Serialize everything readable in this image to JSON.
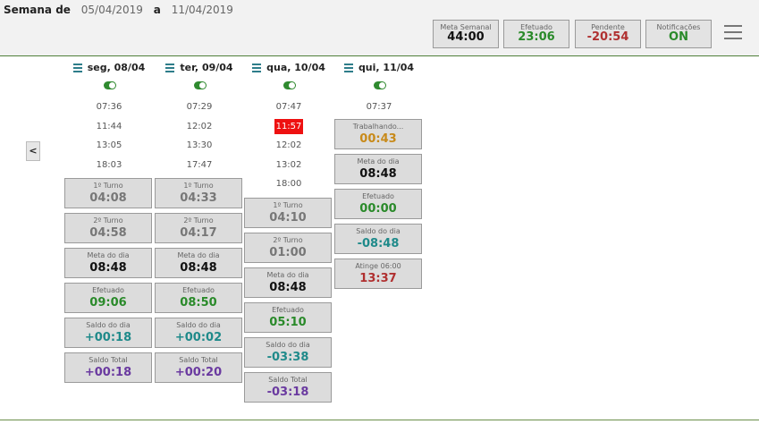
{
  "header": {
    "prefix": "Semana de",
    "start": "05/04/2019",
    "connector": "a",
    "end": "11/04/2019"
  },
  "stats": [
    {
      "label": "Meta Semanal",
      "value": "44:00",
      "color": "#111111"
    },
    {
      "label": "Efetuado",
      "value": "23:06",
      "color": "#2a8a2a"
    },
    {
      "label": "Pendente",
      "value": "-20:54",
      "color": "#b03030"
    },
    {
      "label": "Notificações",
      "value": "ON",
      "color": "#2a8a2a"
    }
  ],
  "colors": {
    "green": "#2a8a2a",
    "teal": "#1f8a8a",
    "purple": "#6a3aa0",
    "red": "#b03030",
    "orange": "#c88a1a"
  },
  "days": [
    {
      "label": "seg, 08/04",
      "punches": [
        "07:36",
        "11:44",
        "13:05",
        "18:03"
      ],
      "cards": [
        {
          "label": "1º Turno",
          "value": "04:08",
          "color": "#777777"
        },
        {
          "label": "2º Turno",
          "value": "04:58",
          "color": "#777777"
        },
        {
          "label": "Meta do dia",
          "value": "08:48",
          "color": "#111111"
        },
        {
          "label": "Efetuado",
          "value": "09:06",
          "color": "#2a8a2a"
        },
        {
          "label": "Saldo do dia",
          "value": "+00:18",
          "color": "#1f8a8a"
        },
        {
          "label": "Saldo Total",
          "value": "+00:18",
          "color": "#6a3aa0"
        }
      ]
    },
    {
      "label": "ter, 09/04",
      "punches": [
        "07:29",
        "12:02",
        "13:30",
        "17:47"
      ],
      "cards": [
        {
          "label": "1º Turno",
          "value": "04:33",
          "color": "#777777"
        },
        {
          "label": "2º Turno",
          "value": "04:17",
          "color": "#777777"
        },
        {
          "label": "Meta do dia",
          "value": "08:48",
          "color": "#111111"
        },
        {
          "label": "Efetuado",
          "value": "08:50",
          "color": "#2a8a2a"
        },
        {
          "label": "Saldo do dia",
          "value": "+00:02",
          "color": "#1f8a8a"
        },
        {
          "label": "Saldo Total",
          "value": "+00:20",
          "color": "#6a3aa0"
        }
      ]
    },
    {
      "label": "qua, 10/04",
      "punches": [
        "07:47",
        "11:57",
        "12:02",
        "13:02",
        "18:00"
      ],
      "highlight": [
        1
      ],
      "cards": [
        {
          "label": "1º Turno",
          "value": "04:10",
          "color": "#777777"
        },
        {
          "label": "2º Turno",
          "value": "01:00",
          "color": "#777777"
        },
        {
          "label": "Meta do dia",
          "value": "08:48",
          "color": "#111111"
        },
        {
          "label": "Efetuado",
          "value": "05:10",
          "color": "#2a8a2a"
        },
        {
          "label": "Saldo do dia",
          "value": "-03:38",
          "color": "#1f8a8a"
        },
        {
          "label": "Saldo Total",
          "value": "-03:18",
          "color": "#6a3aa0"
        }
      ]
    },
    {
      "label": "qui, 11/04",
      "punches": [
        "07:37"
      ],
      "cards": [
        {
          "label": "Trabalhando...",
          "value": "00:43",
          "color": "#c88a1a"
        },
        {
          "label": "Meta do dia",
          "value": "08:48",
          "color": "#111111"
        },
        {
          "label": "Efetuado",
          "value": "00:00",
          "color": "#2a8a2a"
        },
        {
          "label": "Saldo do dia",
          "value": "-08:48",
          "color": "#1f8a8a"
        },
        {
          "label": "Atinge 06:00",
          "value": "13:37",
          "color": "#b03030"
        }
      ]
    }
  ],
  "icons": {
    "menu": "hamburger-menu-icon",
    "prev": "chevron-left-icon",
    "toggle": "toggle-switch-icon"
  }
}
